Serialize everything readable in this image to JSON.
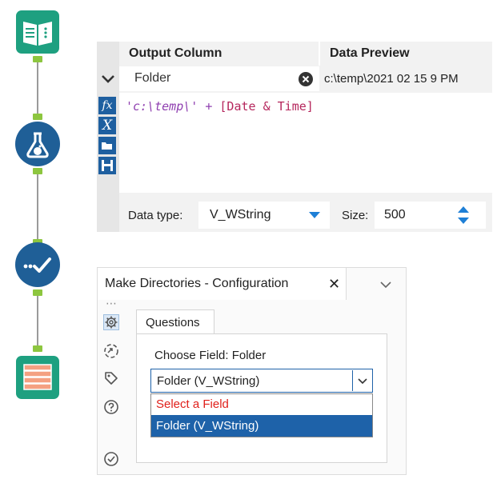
{
  "formula": {
    "header_output_column": "Output Column",
    "header_data_preview": "Data Preview",
    "output_field": "Folder",
    "preview_value": "c:\\temp\\2021 02 15 9 PM",
    "expression_string": "'c:\\temp\\'",
    "expression_op": " + ",
    "expression_field": "[Date & Time]",
    "side_buttons": [
      "fx",
      "X"
    ],
    "datatype_label": "Data type:",
    "datatype_value": "V_WString",
    "size_label": "Size:",
    "size_value": "500"
  },
  "config": {
    "title": "Make Directories  -  Configuration",
    "close_glyph": "✕",
    "tab_label": "Questions",
    "choose_label": "Choose Field: Folder",
    "select_value": "Folder (V_WString)",
    "options": [
      "Select a Field",
      "Folder (V_WString)"
    ],
    "ellipsis": "⋯"
  },
  "colors": {
    "tool_teal": "#1ea080",
    "tool_blue": "#1f5f97",
    "anchor_green": "#8dc63f",
    "select_highlight": "#1e62a9",
    "placeholder_red": "#e0201b"
  },
  "icons": [
    "book-input-icon",
    "flask-formula-icon",
    "checkmark-run-icon",
    "stacked-output-icon"
  ]
}
